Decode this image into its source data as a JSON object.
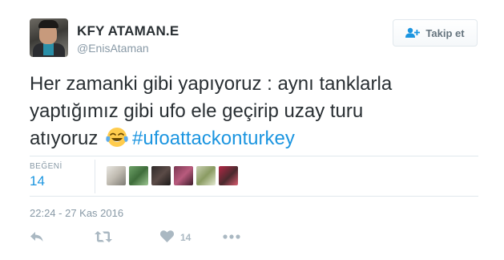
{
  "user": {
    "display_name": "KFY ATAMAN.E",
    "handle": "@EnisAtaman"
  },
  "follow_button": {
    "label": "Takip et",
    "icon": "add-user-icon"
  },
  "tweet": {
    "line1": "Her zamanki gibi yapıyoruz : aynı tanklarla",
    "line2": "yaptığımız gibi ufo ele geçirip uzay turu",
    "line3_prefix": "atıyoruz",
    "emoji": "tears-of-joy-emoji",
    "hashtag": "#ufoattackonturkey"
  },
  "stats": {
    "likes_label": "BEĞENİ",
    "likes_count": "14",
    "liker_avatar_count": 6
  },
  "timestamp": "22:24 - 27 Kas 2016",
  "actions": {
    "reply_icon": "reply-icon",
    "retweet_icon": "retweet-icon",
    "like_icon": "heart-icon",
    "like_count": "14",
    "more_icon": "more-icon"
  },
  "colors": {
    "link": "#1b95e0",
    "text": "#292f33",
    "muted": "#8899a6",
    "action_gray": "#aab8c2"
  }
}
